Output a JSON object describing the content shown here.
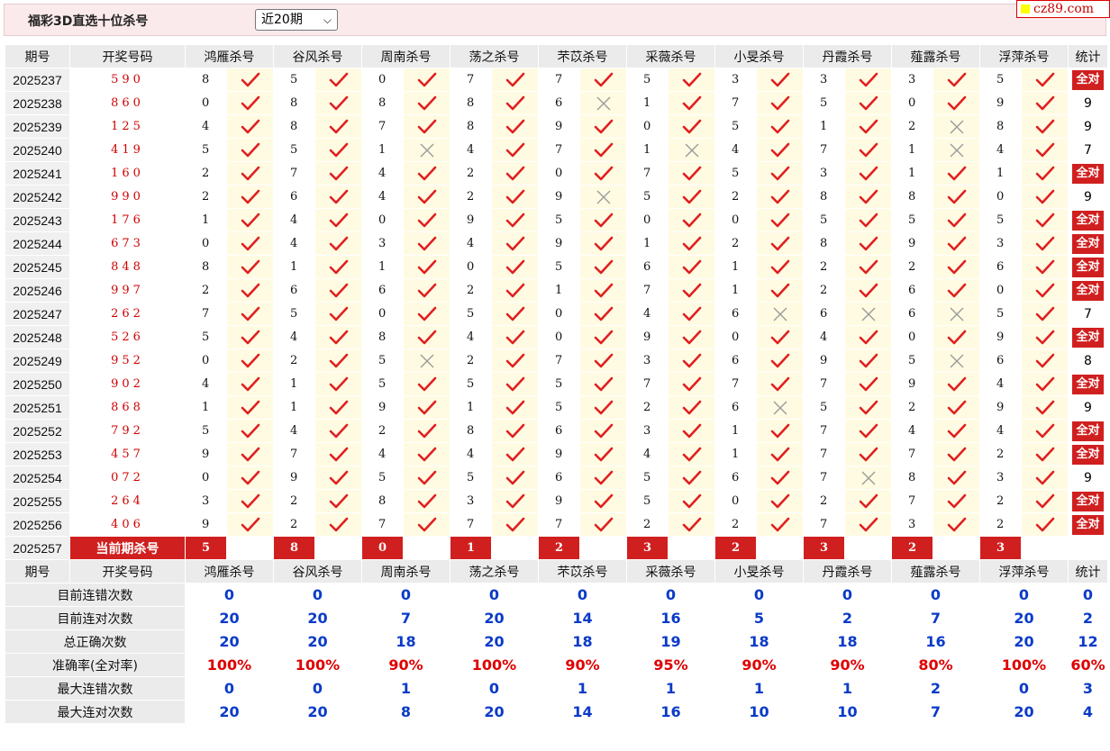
{
  "header": {
    "title": "福彩3D直选十位杀号",
    "period_select": "近20期",
    "logo_text": "cz89.com"
  },
  "columns": [
    "期号",
    "开奖号码",
    "鸿雁杀号",
    "谷风杀号",
    "周南杀号",
    "荡之杀号",
    "芣苡杀号",
    "采薇杀号",
    "小旻杀号",
    "丹霞杀号",
    "薤露杀号",
    "浮萍杀号",
    "统计"
  ],
  "all_label": "全对",
  "rows": [
    {
      "period": "2025237",
      "num": "590",
      "kills": [
        [
          8,
          1
        ],
        [
          5,
          1
        ],
        [
          0,
          1
        ],
        [
          7,
          1
        ],
        [
          7,
          1
        ],
        [
          5,
          1
        ],
        [
          3,
          1
        ],
        [
          3,
          1
        ],
        [
          3,
          1
        ],
        [
          5,
          1
        ]
      ],
      "stat": "全对"
    },
    {
      "period": "2025238",
      "num": "860",
      "kills": [
        [
          0,
          1
        ],
        [
          8,
          1
        ],
        [
          8,
          1
        ],
        [
          8,
          1
        ],
        [
          6,
          0
        ],
        [
          1,
          1
        ],
        [
          7,
          1
        ],
        [
          5,
          1
        ],
        [
          0,
          1
        ],
        [
          9,
          1
        ]
      ],
      "stat": "9"
    },
    {
      "period": "2025239",
      "num": "125",
      "kills": [
        [
          4,
          1
        ],
        [
          8,
          1
        ],
        [
          7,
          1
        ],
        [
          8,
          1
        ],
        [
          9,
          1
        ],
        [
          0,
          1
        ],
        [
          5,
          1
        ],
        [
          1,
          1
        ],
        [
          2,
          0
        ],
        [
          8,
          1
        ]
      ],
      "stat": "9"
    },
    {
      "period": "2025240",
      "num": "419",
      "kills": [
        [
          5,
          1
        ],
        [
          5,
          1
        ],
        [
          1,
          0
        ],
        [
          4,
          1
        ],
        [
          7,
          1
        ],
        [
          1,
          0
        ],
        [
          4,
          1
        ],
        [
          7,
          1
        ],
        [
          1,
          0
        ],
        [
          4,
          1
        ]
      ],
      "stat": "7"
    },
    {
      "period": "2025241",
      "num": "160",
      "kills": [
        [
          2,
          1
        ],
        [
          7,
          1
        ],
        [
          4,
          1
        ],
        [
          2,
          1
        ],
        [
          0,
          1
        ],
        [
          7,
          1
        ],
        [
          5,
          1
        ],
        [
          3,
          1
        ],
        [
          1,
          1
        ],
        [
          1,
          1
        ]
      ],
      "stat": "全对"
    },
    {
      "period": "2025242",
      "num": "990",
      "kills": [
        [
          2,
          1
        ],
        [
          6,
          1
        ],
        [
          4,
          1
        ],
        [
          2,
          1
        ],
        [
          9,
          0
        ],
        [
          5,
          1
        ],
        [
          2,
          1
        ],
        [
          8,
          1
        ],
        [
          8,
          1
        ],
        [
          0,
          1
        ]
      ],
      "stat": "9"
    },
    {
      "period": "2025243",
      "num": "176",
      "kills": [
        [
          1,
          1
        ],
        [
          4,
          1
        ],
        [
          0,
          1
        ],
        [
          9,
          1
        ],
        [
          5,
          1
        ],
        [
          0,
          1
        ],
        [
          0,
          1
        ],
        [
          5,
          1
        ],
        [
          5,
          1
        ],
        [
          5,
          1
        ]
      ],
      "stat": "全对"
    },
    {
      "period": "2025244",
      "num": "673",
      "kills": [
        [
          0,
          1
        ],
        [
          4,
          1
        ],
        [
          3,
          1
        ],
        [
          4,
          1
        ],
        [
          9,
          1
        ],
        [
          1,
          1
        ],
        [
          2,
          1
        ],
        [
          8,
          1
        ],
        [
          9,
          1
        ],
        [
          3,
          1
        ]
      ],
      "stat": "全对"
    },
    {
      "period": "2025245",
      "num": "848",
      "kills": [
        [
          8,
          1
        ],
        [
          1,
          1
        ],
        [
          1,
          1
        ],
        [
          0,
          1
        ],
        [
          5,
          1
        ],
        [
          6,
          1
        ],
        [
          1,
          1
        ],
        [
          2,
          1
        ],
        [
          2,
          1
        ],
        [
          6,
          1
        ]
      ],
      "stat": "全对"
    },
    {
      "period": "2025246",
      "num": "997",
      "kills": [
        [
          2,
          1
        ],
        [
          6,
          1
        ],
        [
          6,
          1
        ],
        [
          2,
          1
        ],
        [
          1,
          1
        ],
        [
          7,
          1
        ],
        [
          1,
          1
        ],
        [
          2,
          1
        ],
        [
          6,
          1
        ],
        [
          0,
          1
        ]
      ],
      "stat": "全对"
    },
    {
      "period": "2025247",
      "num": "262",
      "kills": [
        [
          7,
          1
        ],
        [
          5,
          1
        ],
        [
          0,
          1
        ],
        [
          5,
          1
        ],
        [
          0,
          1
        ],
        [
          4,
          1
        ],
        [
          6,
          0
        ],
        [
          6,
          0
        ],
        [
          6,
          0
        ],
        [
          5,
          1
        ]
      ],
      "stat": "7"
    },
    {
      "period": "2025248",
      "num": "526",
      "kills": [
        [
          5,
          1
        ],
        [
          4,
          1
        ],
        [
          8,
          1
        ],
        [
          4,
          1
        ],
        [
          0,
          1
        ],
        [
          9,
          1
        ],
        [
          0,
          1
        ],
        [
          4,
          1
        ],
        [
          0,
          1
        ],
        [
          9,
          1
        ]
      ],
      "stat": "全对"
    },
    {
      "period": "2025249",
      "num": "952",
      "kills": [
        [
          0,
          1
        ],
        [
          2,
          1
        ],
        [
          5,
          0
        ],
        [
          2,
          1
        ],
        [
          7,
          1
        ],
        [
          3,
          1
        ],
        [
          6,
          1
        ],
        [
          9,
          1
        ],
        [
          5,
          0
        ],
        [
          6,
          1
        ]
      ],
      "stat": "8"
    },
    {
      "period": "2025250",
      "num": "902",
      "kills": [
        [
          4,
          1
        ],
        [
          1,
          1
        ],
        [
          5,
          1
        ],
        [
          5,
          1
        ],
        [
          5,
          1
        ],
        [
          7,
          1
        ],
        [
          7,
          1
        ],
        [
          7,
          1
        ],
        [
          9,
          1
        ],
        [
          4,
          1
        ]
      ],
      "stat": "全对"
    },
    {
      "period": "2025251",
      "num": "868",
      "kills": [
        [
          1,
          1
        ],
        [
          1,
          1
        ],
        [
          9,
          1
        ],
        [
          1,
          1
        ],
        [
          5,
          1
        ],
        [
          2,
          1
        ],
        [
          6,
          0
        ],
        [
          5,
          1
        ],
        [
          2,
          1
        ],
        [
          9,
          1
        ]
      ],
      "stat": "9"
    },
    {
      "period": "2025252",
      "num": "792",
      "kills": [
        [
          5,
          1
        ],
        [
          4,
          1
        ],
        [
          2,
          1
        ],
        [
          8,
          1
        ],
        [
          6,
          1
        ],
        [
          3,
          1
        ],
        [
          1,
          1
        ],
        [
          7,
          1
        ],
        [
          4,
          1
        ],
        [
          4,
          1
        ]
      ],
      "stat": "全对"
    },
    {
      "period": "2025253",
      "num": "457",
      "kills": [
        [
          9,
          1
        ],
        [
          7,
          1
        ],
        [
          4,
          1
        ],
        [
          4,
          1
        ],
        [
          9,
          1
        ],
        [
          4,
          1
        ],
        [
          1,
          1
        ],
        [
          7,
          1
        ],
        [
          7,
          1
        ],
        [
          2,
          1
        ]
      ],
      "stat": "全对"
    },
    {
      "period": "2025254",
      "num": "072",
      "kills": [
        [
          0,
          1
        ],
        [
          9,
          1
        ],
        [
          5,
          1
        ],
        [
          5,
          1
        ],
        [
          6,
          1
        ],
        [
          5,
          1
        ],
        [
          6,
          1
        ],
        [
          7,
          0
        ],
        [
          8,
          1
        ],
        [
          3,
          1
        ]
      ],
      "stat": "9"
    },
    {
      "period": "2025255",
      "num": "264",
      "kills": [
        [
          3,
          1
        ],
        [
          2,
          1
        ],
        [
          8,
          1
        ],
        [
          3,
          1
        ],
        [
          9,
          1
        ],
        [
          5,
          1
        ],
        [
          0,
          1
        ],
        [
          2,
          1
        ],
        [
          7,
          1
        ],
        [
          2,
          1
        ]
      ],
      "stat": "全对"
    },
    {
      "period": "2025256",
      "num": "406",
      "kills": [
        [
          9,
          1
        ],
        [
          2,
          1
        ],
        [
          7,
          1
        ],
        [
          7,
          1
        ],
        [
          7,
          1
        ],
        [
          2,
          1
        ],
        [
          2,
          1
        ],
        [
          7,
          1
        ],
        [
          3,
          1
        ],
        [
          2,
          1
        ]
      ],
      "stat": "全对"
    }
  ],
  "current": {
    "period": "2025257",
    "label": "当前期杀号",
    "picks": [
      "5",
      "8",
      "0",
      "1",
      "2",
      "3",
      "2",
      "3",
      "2",
      "3"
    ]
  },
  "stats": [
    {
      "label": "目前连错次数",
      "values": [
        "0",
        "0",
        "0",
        "0",
        "0",
        "0",
        "0",
        "0",
        "0",
        "0"
      ],
      "total": "0",
      "red": false
    },
    {
      "label": "目前连对次数",
      "values": [
        "20",
        "20",
        "7",
        "20",
        "14",
        "16",
        "5",
        "2",
        "7",
        "20"
      ],
      "total": "2",
      "red": false
    },
    {
      "label": "总正确次数",
      "values": [
        "20",
        "20",
        "18",
        "20",
        "18",
        "19",
        "18",
        "18",
        "16",
        "20"
      ],
      "total": "12",
      "red": false
    },
    {
      "label": "准确率(全对率)",
      "values": [
        "100%",
        "100%",
        "90%",
        "100%",
        "90%",
        "95%",
        "90%",
        "90%",
        "80%",
        "100%"
      ],
      "total": "60%",
      "red": true
    },
    {
      "label": "最大连错次数",
      "values": [
        "0",
        "0",
        "1",
        "0",
        "1",
        "1",
        "1",
        "1",
        "2",
        "0"
      ],
      "total": "3",
      "red": false
    },
    {
      "label": "最大连对次数",
      "values": [
        "20",
        "20",
        "8",
        "20",
        "14",
        "16",
        "10",
        "10",
        "7",
        "20"
      ],
      "total": "4",
      "red": false
    }
  ],
  "colors": {
    "accent": "#d01f1f",
    "check": "#e02020",
    "cross": "#9a9a9a",
    "mark_bg": "#fffbe3",
    "stat_blue": "#0a3bc8"
  }
}
